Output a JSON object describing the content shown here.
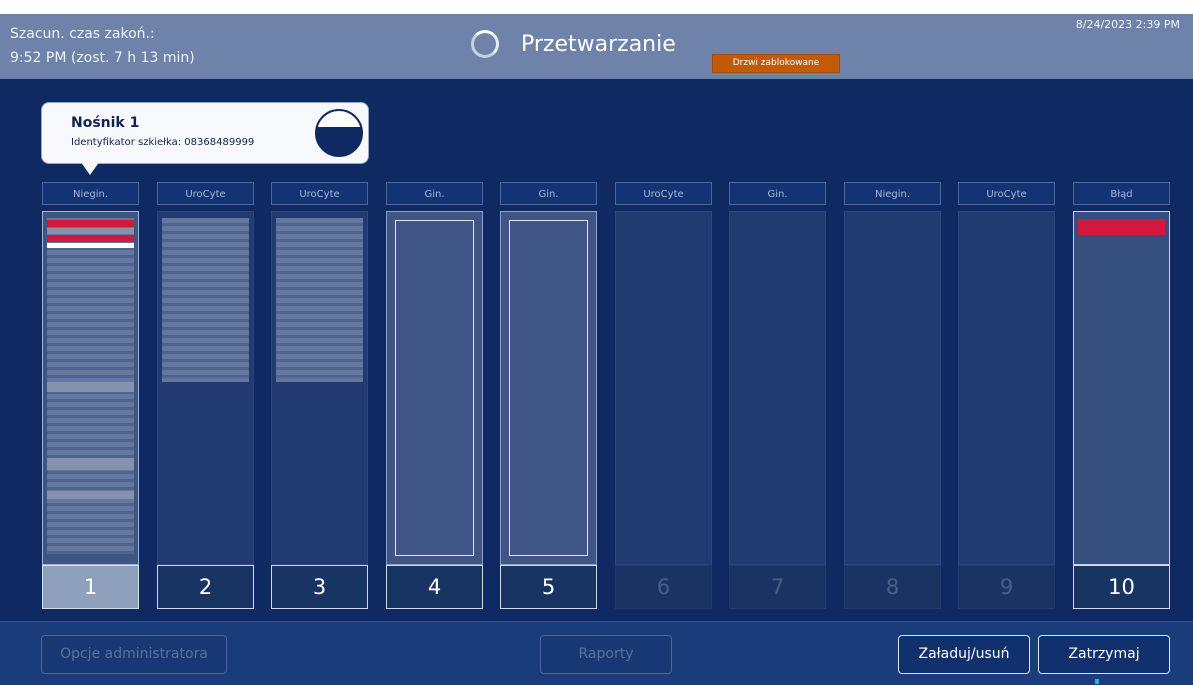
{
  "header": {
    "eta_label": "Szacun. czas zakoń.:",
    "eta_value": "9:52 PM (zost. 7 h 13 min)",
    "status_title": "Przetwarzanie",
    "door_badge": "Drzwi zablokowane",
    "datetime": "8/24/2023 2:39 PM"
  },
  "tooltip": {
    "title": "Nośnik 1",
    "slide_id": "Identyfikator szkiełka: 08368489999"
  },
  "racks": [
    {
      "label": "Niegin.",
      "number": "1"
    },
    {
      "label": "UroCyte",
      "number": "2"
    },
    {
      "label": "UroCyte",
      "number": "3"
    },
    {
      "label": "Gin.",
      "number": "4"
    },
    {
      "label": "Gin.",
      "number": "5"
    },
    {
      "label": "UroCyte",
      "number": "6"
    },
    {
      "label": "Gin.",
      "number": "7"
    },
    {
      "label": "Niegin.",
      "number": "8"
    },
    {
      "label": "UroCyte",
      "number": "9"
    },
    {
      "label": "Błąd",
      "number": "10"
    }
  ],
  "bottom": {
    "admin_button": "Opcje administratora",
    "reports_button": "Raporty",
    "load_button": "Załaduj/usuń",
    "stop_button": "Zatrzymaj"
  }
}
